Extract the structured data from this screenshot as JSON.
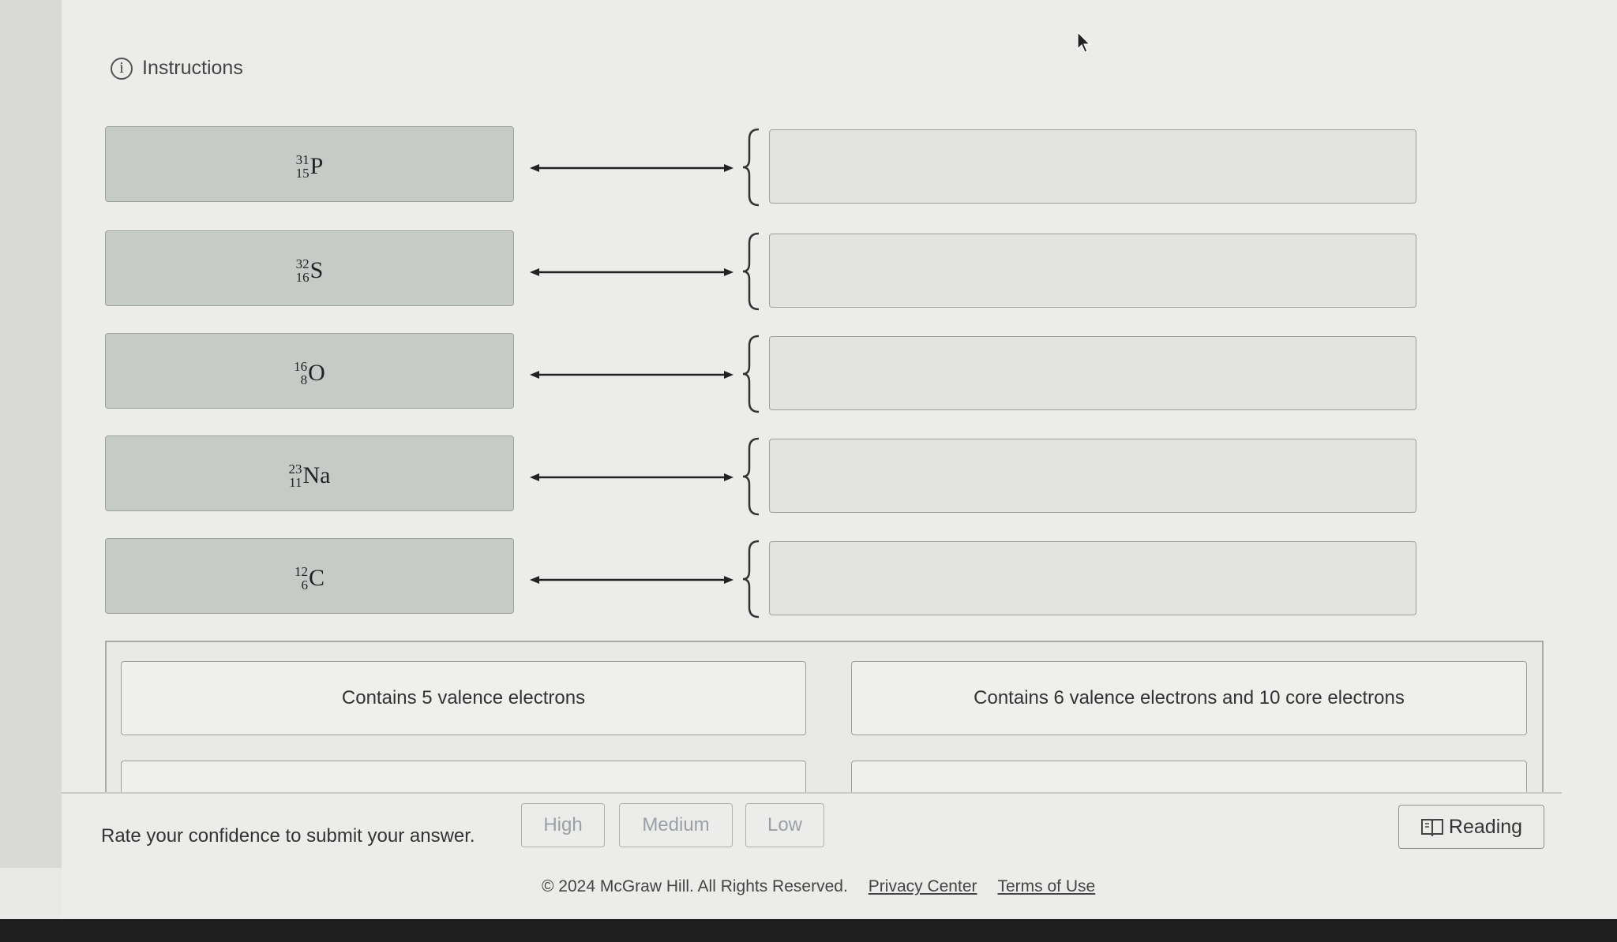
{
  "instructions_label": "Instructions",
  "prompts": [
    {
      "mass": "31",
      "atomic": "15",
      "symbol": "P"
    },
    {
      "mass": "32",
      "atomic": "16",
      "symbol": "S"
    },
    {
      "mass": "16",
      "atomic": "8",
      "symbol": "O"
    },
    {
      "mass": "23",
      "atomic": "11",
      "symbol": "Na"
    },
    {
      "mass": "12",
      "atomic": "6",
      "symbol": "C"
    }
  ],
  "choices": [
    "Contains 5 valence electrons",
    "Contains 6 valence electrons and 10 core electrons"
  ],
  "footer": {
    "confidence_label": "Rate your confidence to submit your answer.",
    "high": "High",
    "medium": "Medium",
    "low": "Low",
    "reading": "Reading"
  },
  "legal": {
    "copyright": "© 2024 McGraw Hill. All Rights Reserved.",
    "privacy": "Privacy Center",
    "terms": "Terms of Use"
  }
}
